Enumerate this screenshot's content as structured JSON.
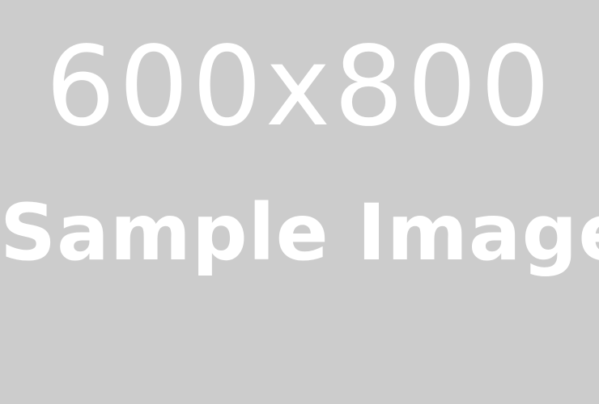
{
  "placeholder": {
    "dimensions_label": "600x800",
    "caption": "Sample Image",
    "background_color": "#cccccc",
    "text_color": "#ffffff"
  }
}
